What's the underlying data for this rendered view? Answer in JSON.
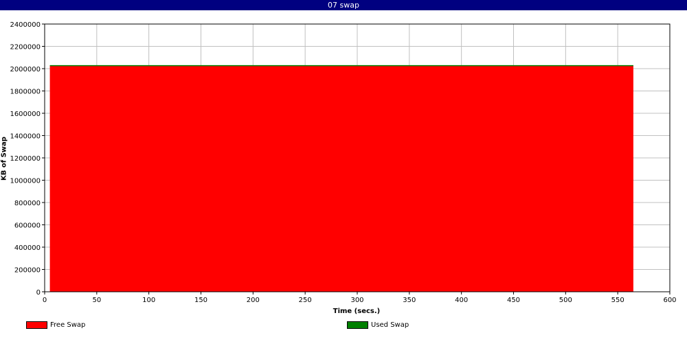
{
  "window": {
    "title": "07 swap",
    "title_bg": "#000080"
  },
  "chart_data": {
    "type": "area",
    "title": "07 swap",
    "xlabel": "Time (secs.)",
    "ylabel": "KB of Swap",
    "xlim": [
      0,
      600
    ],
    "ylim": [
      0,
      2400000
    ],
    "grid": true,
    "xticks": [
      0,
      50,
      100,
      150,
      200,
      250,
      300,
      350,
      400,
      450,
      500,
      550,
      600
    ],
    "yticks": [
      0,
      200000,
      400000,
      600000,
      800000,
      1000000,
      1200000,
      1400000,
      1600000,
      1800000,
      2000000,
      2200000,
      2400000
    ],
    "x": [
      5,
      565
    ],
    "series": [
      {
        "name": "Free Swap",
        "color": "#ff0000",
        "values": [
          2027000,
          2027000
        ]
      },
      {
        "name": "Used Swap",
        "color": "#008000",
        "values": [
          0,
          0
        ]
      }
    ],
    "legend_position": "bottom"
  }
}
